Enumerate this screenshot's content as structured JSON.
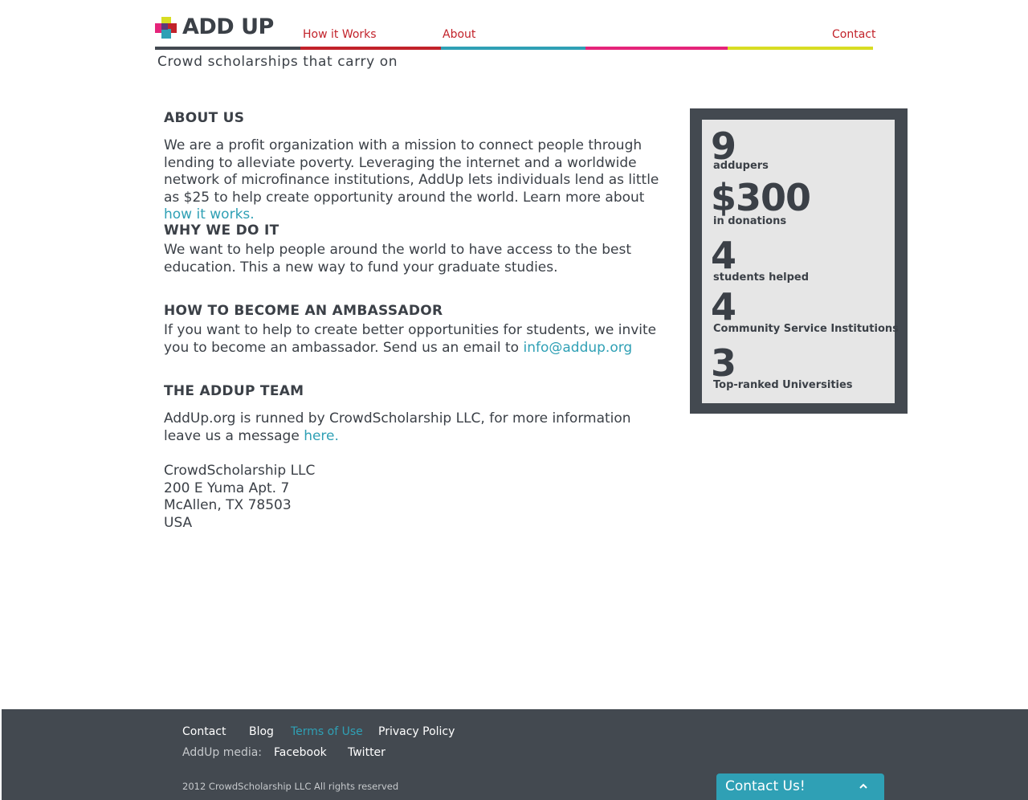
{
  "header": {
    "brand": "ADD UP",
    "tagline": "Crowd scholarships that carry on",
    "nav": [
      {
        "label": "How it Works"
      },
      {
        "label": "About"
      },
      {
        "label": "Contact"
      }
    ],
    "bar_colors": [
      "#434950",
      "#c2222a",
      "#2fa0b5",
      "#e5247a",
      "#d8dd23"
    ]
  },
  "main": {
    "about_title": "ABOUT US",
    "about_text": "We are a profit organization with a mission to connect people through lending to alleviate poverty. Leveraging the internet and a worldwide network of microfinance institutions, AddUp lets individuals lend as little as $25 to help create opportunity around the world. Learn more about ",
    "about_link": "how it works.",
    "why_title": "WHY WE DO IT",
    "why_text": "We want to help people around the world to have access to the best education. This a new way to fund your graduate studies.",
    "ambassador_title": "HOW TO BECOME AN AMBASSADOR",
    "ambassador_text": "If you want to help to create better opportunities for students, we invite you to become an ambassador. Send us an email to ",
    "ambassador_email": "info@addup.org",
    "team_title": "THE ADDUP TEAM",
    "team_text": "AddUp.org is runned by CrowdScholarship LLC, for more information leave us a message ",
    "team_link": "here.",
    "address": [
      "CrowdScholarship LLC",
      "200 E Yuma Apt. 7",
      "McAllen, TX 78503",
      "USA"
    ]
  },
  "stats": [
    {
      "value": "9",
      "label": "addupers"
    },
    {
      "value": "$300",
      "label": "in donations"
    },
    {
      "value": "4",
      "label": "students helped"
    },
    {
      "value": "4",
      "label": "Community Service Institutions"
    },
    {
      "value": "3",
      "label": "Top-ranked Universities"
    }
  ],
  "footer": {
    "links": [
      "Contact",
      "Blog",
      "Terms of Use",
      "Privacy Policy"
    ],
    "media_label": "AddUp media:",
    "media_links": [
      "Facebook",
      "Twitter"
    ],
    "copyright": "2012 CrowdScholarship LLC All rights reserved",
    "contact_widget": "Contact Us!"
  },
  "colors": {
    "accent": "#2fa0b5",
    "nav_red": "#c2222a",
    "dark": "#434950"
  }
}
